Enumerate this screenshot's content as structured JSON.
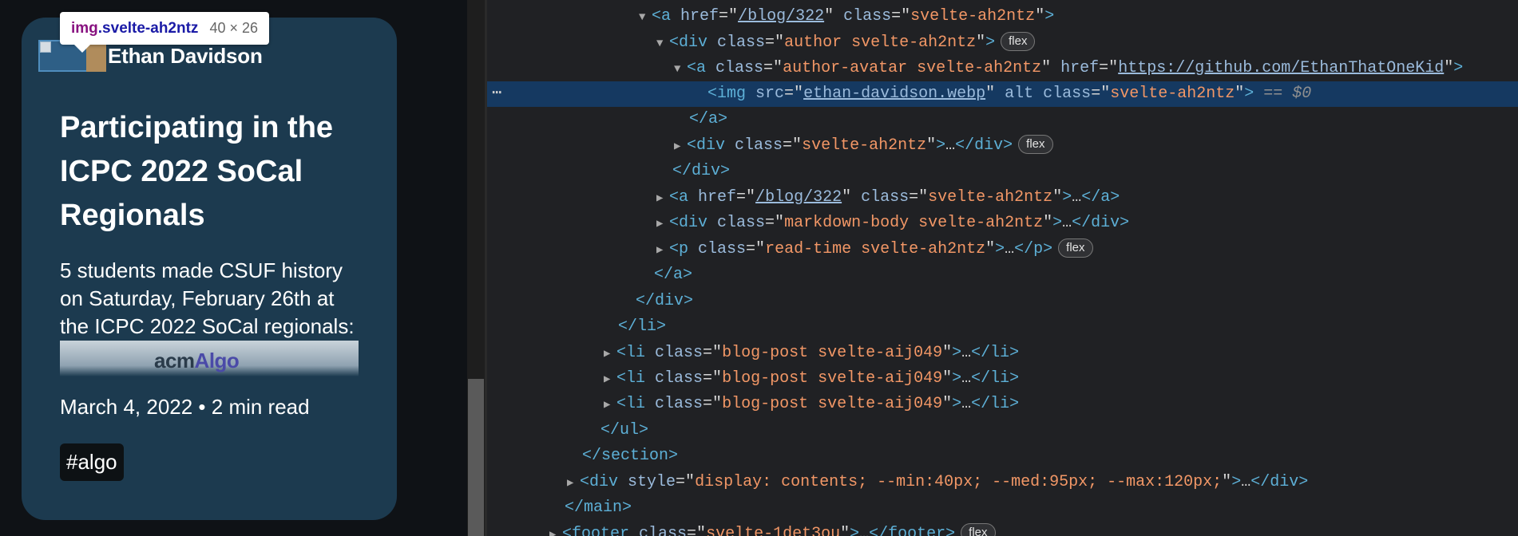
{
  "page": {
    "author_name": "Ethan Davidson",
    "title": "Participating in the ICPC 2022 SoCal Regionals",
    "excerpt": "5 students made CSUF history on Saturday, February 26th at the ICPC 2022 SoCal regionals:",
    "preview_logo_a": "acm",
    "preview_logo_b": "Algo",
    "meta": "March 4, 2022 • 2 min read",
    "tag": "#algo"
  },
  "tooltip": {
    "tag": "img",
    "class": ".svelte-ah2ntz",
    "dims": "40 × 26"
  },
  "devtools": {
    "more_glyph": "⋯",
    "badge_flex": "flex",
    "ellipsis": "…",
    "selected_suffix": " == $0"
  },
  "colors": {
    "card_bg": "#1c3a4f",
    "selection_bg": "#153961",
    "tag_color": "#5db0d7",
    "attr_value_color": "#f29766"
  }
}
